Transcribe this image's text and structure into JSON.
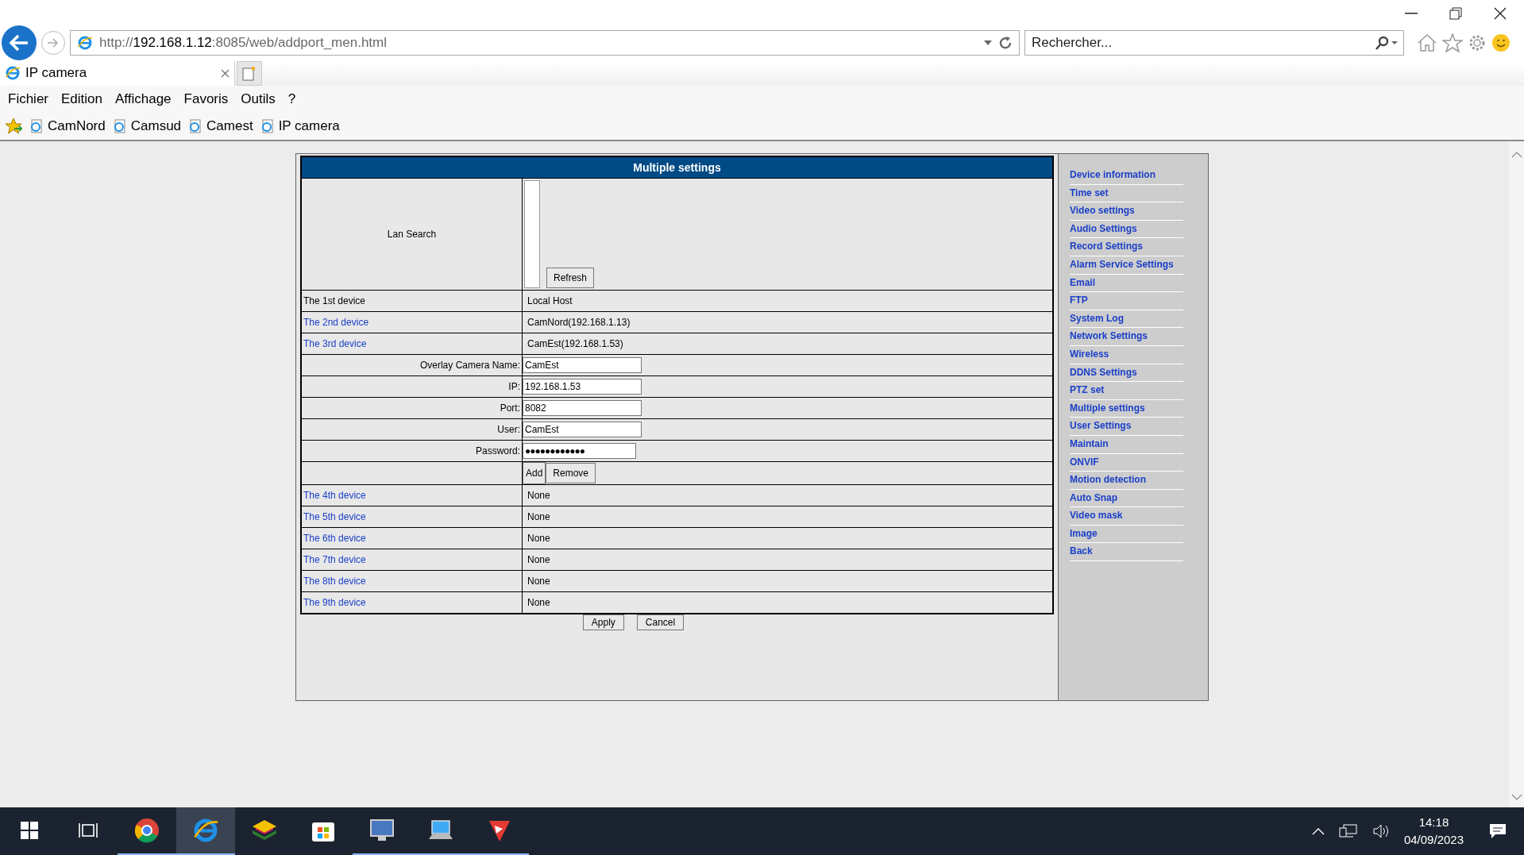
{
  "browser": {
    "address": {
      "scheme": "http://",
      "host": "192.168.1.12",
      "rest": ":8085/web/addport_men.html"
    },
    "search": {
      "placeholder": "Rechercher..."
    },
    "tabs": [
      {
        "label": "IP camera",
        "selected": true
      }
    ],
    "menu": [
      "Fichier",
      "Edition",
      "Affichage",
      "Favoris",
      "Outils",
      "?"
    ],
    "favorites": [
      "CamNord",
      "Camsud",
      "Camest",
      "IP camera"
    ]
  },
  "page": {
    "title": "Multiple settings",
    "lan_search": {
      "label": "Lan Search",
      "button": "Refresh"
    },
    "devices_top": [
      {
        "label": "The 1st device",
        "link": false,
        "value": "Local Host"
      },
      {
        "label": "The 2nd device",
        "link": true,
        "value": "CamNord(192.168.1.13)"
      },
      {
        "label": "The 3rd device",
        "link": true,
        "value": "CamEst(192.168.1.53)"
      }
    ],
    "form": [
      {
        "label": "Overlay Camera Name:",
        "kind": "text",
        "value": "CamEst"
      },
      {
        "label": "IP:",
        "kind": "text",
        "value": "192.168.1.53"
      },
      {
        "label": "Port:",
        "kind": "text",
        "value": "8082"
      },
      {
        "label": "User:",
        "kind": "text",
        "value": "CamEst"
      },
      {
        "label": "Password:",
        "kind": "password",
        "value": "●●●●●●●●●●●●"
      }
    ],
    "form_buttons": [
      "Add",
      "Remove"
    ],
    "devices_bottom": [
      {
        "label": "The 4th device",
        "link": true,
        "value": "None"
      },
      {
        "label": "The 5th device",
        "link": true,
        "value": "None"
      },
      {
        "label": "The 6th device",
        "link": true,
        "value": "None"
      },
      {
        "label": "The 7th device",
        "link": true,
        "value": "None"
      },
      {
        "label": "The 8th device",
        "link": true,
        "value": "None"
      },
      {
        "label": "The 9th device",
        "link": true,
        "value": "None"
      }
    ],
    "actions": [
      "Apply",
      "Cancel"
    ]
  },
  "sidebar": [
    {
      "label": "Device information",
      "selected": false
    },
    {
      "label": "Time set",
      "selected": false
    },
    {
      "label": "Video settings",
      "selected": false
    },
    {
      "label": "Audio Settings",
      "selected": false
    },
    {
      "label": "Record Settings",
      "selected": false
    },
    {
      "label": "Alarm Service Settings",
      "selected": false
    },
    {
      "label": "Email",
      "selected": false
    },
    {
      "label": "FTP",
      "selected": false
    },
    {
      "label": "System Log",
      "selected": false
    },
    {
      "label": "Network Settings",
      "selected": false
    },
    {
      "label": "Wireless",
      "selected": false
    },
    {
      "label": "DDNS Settings",
      "selected": false
    },
    {
      "label": "PTZ set",
      "selected": false
    },
    {
      "label": "Multiple settings",
      "selected": false
    },
    {
      "label": "User Settings",
      "selected": false
    },
    {
      "label": "Maintain",
      "selected": false
    },
    {
      "label": "ONVIF",
      "selected": false
    },
    {
      "label": "Motion detection",
      "selected": false
    },
    {
      "label": "Auto Snap",
      "selected": false
    },
    {
      "label": "Video mask",
      "selected": false
    },
    {
      "label": "Image",
      "selected": false
    },
    {
      "label": "Back",
      "selected": false
    }
  ],
  "taskbar": {
    "apps": [
      {
        "selected": false
      },
      {
        "selected": false
      },
      {
        "selected": false
      },
      {
        "selected": true
      },
      {
        "selected": false
      },
      {
        "selected": false
      },
      {
        "selected": false
      },
      {
        "selected": false
      },
      {
        "selected": false
      }
    ],
    "time": "14:18",
    "date": "04/09/2023"
  }
}
